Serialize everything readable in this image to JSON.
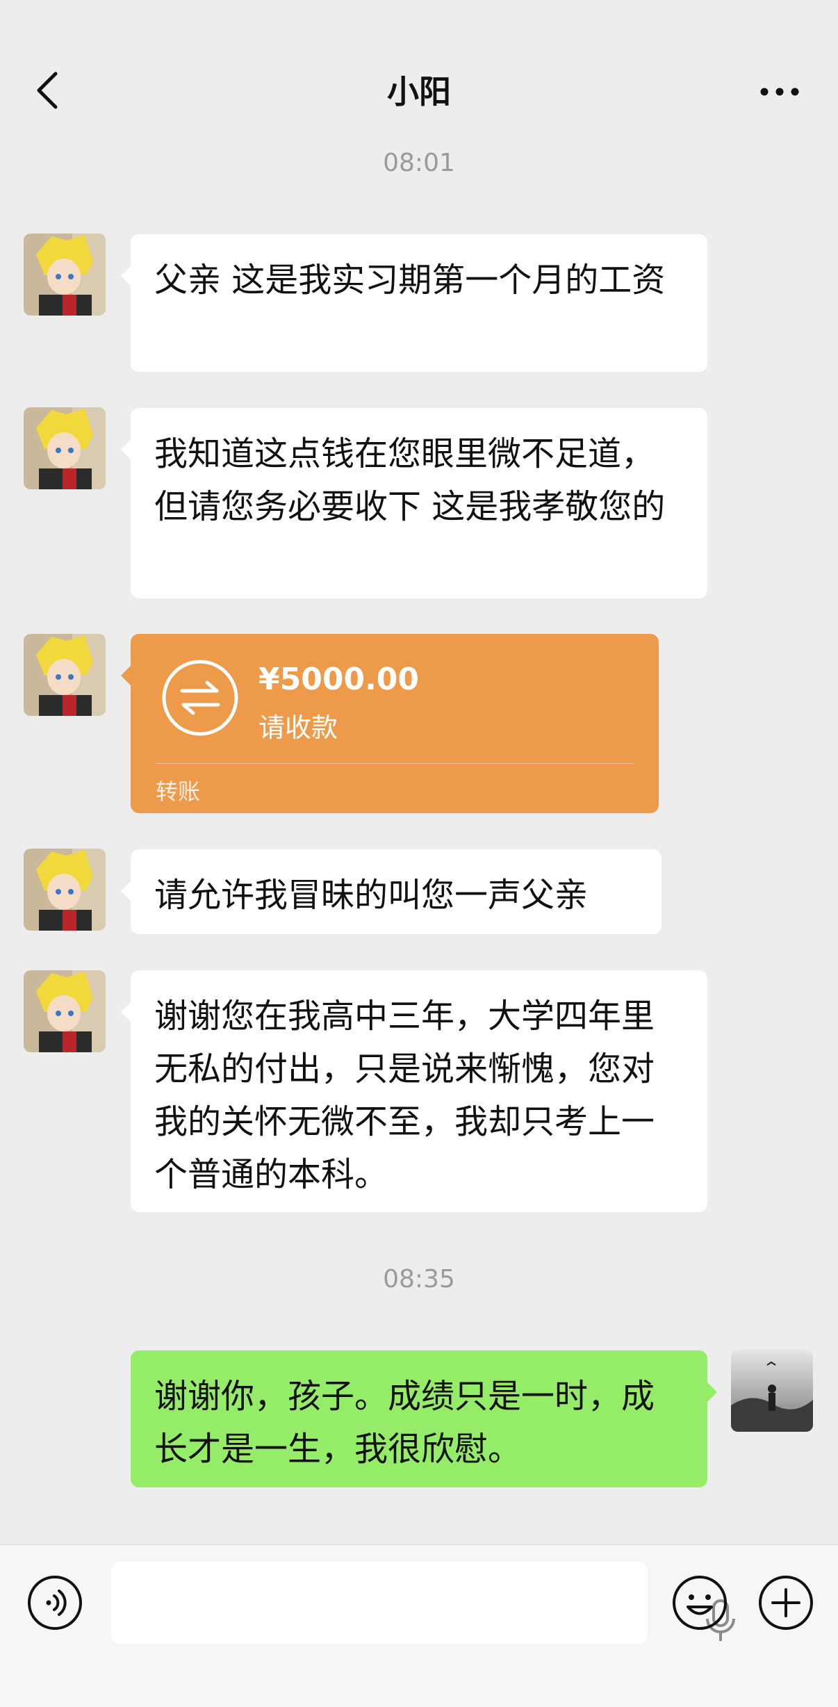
{
  "header": {
    "title": "小阳"
  },
  "timestamps": [
    "08:01",
    "08:35"
  ],
  "messages": [
    {
      "from": "other",
      "text": "父亲 这是我实习期第一个月的工资"
    },
    {
      "from": "other",
      "text": "我知道这点钱在您眼里微不足道，但请您务必要收下 这是我孝敬您的"
    },
    {
      "from": "other",
      "text": "请允许我冒昧的叫您一声父亲"
    },
    {
      "from": "other",
      "text": "谢谢您在我高中三年，大学四年里无私的付出，只是说来惭愧，您对我的关怀无微不至，我却只考上一个普通的本科。"
    },
    {
      "from": "me",
      "text": "谢谢你，孩子。成绩只是一时，成长才是一生，我很欣慰。"
    }
  ],
  "transfer": {
    "amount": "¥5000.00",
    "status": "请收款",
    "label": "转账"
  },
  "colors": {
    "accent_green": "#95ec69",
    "transfer_orange": "#ed9a4a",
    "background": "#ededed"
  }
}
